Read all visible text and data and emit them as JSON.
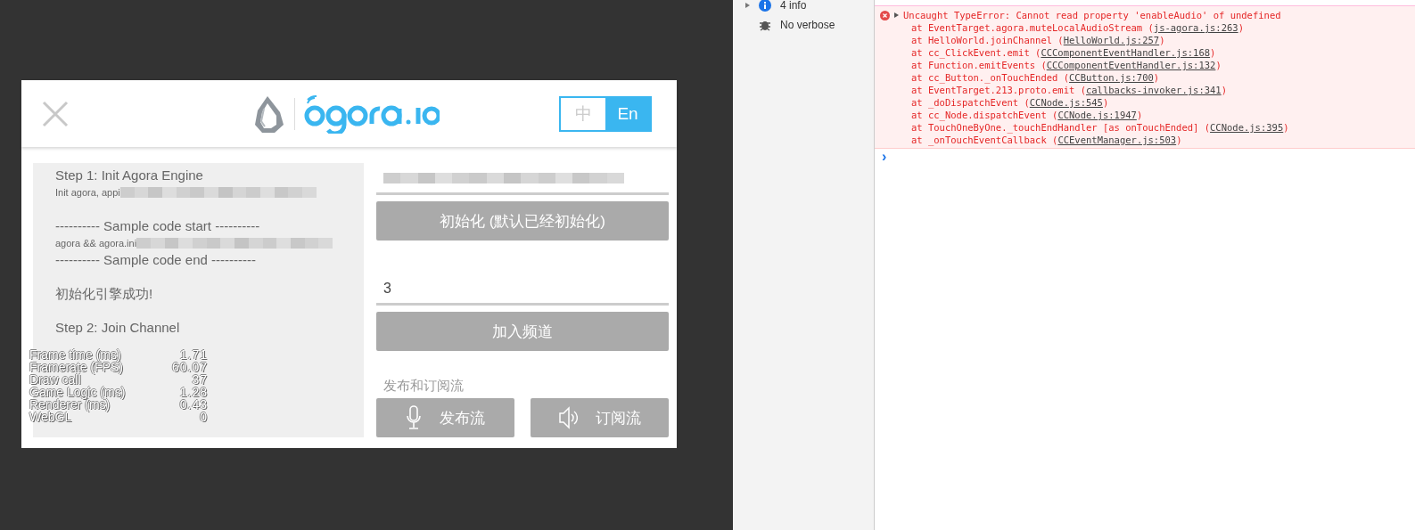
{
  "game": {
    "lang_toggle": [
      {
        "label": "中",
        "selected": false
      },
      {
        "label": "En",
        "selected": true
      }
    ],
    "log": [
      {
        "kind": "title",
        "text": "Step 1: Init Agora Engine"
      },
      {
        "kind": "redacted",
        "text": "Init agora, appi"
      },
      {
        "kind": "gap"
      },
      {
        "kind": "title",
        "text": "---------- Sample code start ----------"
      },
      {
        "kind": "redacted",
        "text": "agora && agora.ini"
      },
      {
        "kind": "title",
        "text": "---------- Sample code end   ----------"
      },
      {
        "kind": "gap"
      },
      {
        "kind": "title",
        "text": "初始化引擎成功!"
      },
      {
        "kind": "gap"
      },
      {
        "kind": "title",
        "text": "Step 2: Join Channel"
      }
    ],
    "stats": [
      {
        "label": "Frame time (ms)",
        "value": "1.71"
      },
      {
        "label": "Framerate (FPS)",
        "value": "60.07"
      },
      {
        "label": "Draw call",
        "value": "37"
      },
      {
        "label": "Game Logic (ms)",
        "value": "1.28"
      },
      {
        "label": "Renderer (ms)",
        "value": "0.43"
      },
      {
        "label": "WebGL",
        "value": "0"
      }
    ],
    "init_button": "初始化 (默认已经初始化)",
    "channel_field": {
      "value": "3"
    },
    "join_button": "加入频道",
    "section_label": "发布和订阅流",
    "stream_buttons": [
      {
        "kind": "mic",
        "label": "发布流"
      },
      {
        "kind": "speaker",
        "label": "订阅流"
      }
    ]
  },
  "devtools": {
    "sidebar": [
      {
        "kind": "info",
        "label": "4 info"
      },
      {
        "kind": "bug",
        "label": "No verbose"
      }
    ],
    "error": {
      "message": "Uncaught TypeError: Cannot read property 'enableAudio' of undefined",
      "stack": [
        {
          "at": "at EventTarget.agora.muteLocalAudioStream (",
          "link": "js-agora.js:263",
          "end": ")"
        },
        {
          "at": "at HelloWorld.joinChannel (",
          "link": "HelloWorld.js:257",
          "end": ")"
        },
        {
          "at": "at cc_ClickEvent.emit (",
          "link": "CCComponentEventHandler.js:168",
          "end": ")"
        },
        {
          "at": "at Function.emitEvents (",
          "link": "CCComponentEventHandler.js:132",
          "end": ")"
        },
        {
          "at": "at cc_Button._onTouchEnded (",
          "link": "CCButton.js:700",
          "end": ")"
        },
        {
          "at": "at EventTarget.213.proto.emit (",
          "link": "callbacks-invoker.js:341",
          "end": ")"
        },
        {
          "at": "at _doDispatchEvent (",
          "link": "CCNode.js:545",
          "end": ")"
        },
        {
          "at": "at cc_Node.dispatchEvent (",
          "link": "CCNode.js:1947",
          "end": ")"
        },
        {
          "at": "at TouchOneByOne._touchEndHandler [as onTouchEnded] (",
          "link": "CCNode.js:395",
          "end": ")"
        },
        {
          "at": "at _onTouchEventCallback (",
          "link": "CCEventManager.js:503",
          "end": ")"
        }
      ]
    },
    "prompt": "›"
  }
}
